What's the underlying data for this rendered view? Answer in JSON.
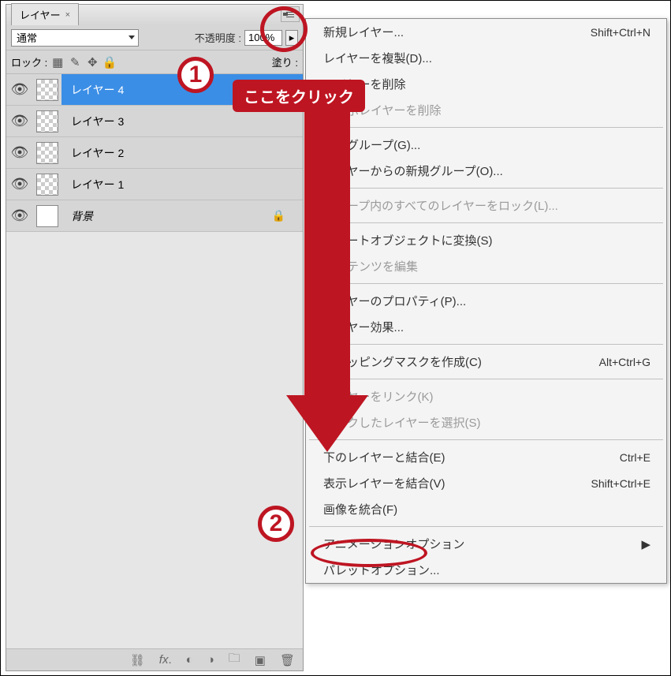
{
  "panel": {
    "tab_label": "レイヤー",
    "blend_mode": "通常",
    "opacity_label": "不透明度 :",
    "opacity_value": "100%",
    "lock_label": "ロック :",
    "fill_label": "塗り :"
  },
  "layers": [
    {
      "name": "レイヤー 4",
      "selected": true,
      "bg": false
    },
    {
      "name": "レイヤー 3",
      "selected": false,
      "bg": false
    },
    {
      "name": "レイヤー 2",
      "selected": false,
      "bg": false
    },
    {
      "name": "レイヤー 1",
      "selected": false,
      "bg": false
    },
    {
      "name": "背景",
      "selected": false,
      "bg": true
    }
  ],
  "menu": {
    "new_layer": "新規レイヤー...",
    "new_layer_sc": "Shift+Ctrl+N",
    "duplicate": "レイヤーを複製(D)...",
    "delete": "レイヤーを削除",
    "delete_hidden": "非表示レイヤーを削除",
    "new_group": "新規グループ(G)...",
    "group_from_layers": "レイヤーからの新規グループ(O)...",
    "lock_all_in_group": "グループ内のすべてのレイヤーをロック(L)...",
    "smart_object": "スマートオブジェクトに変換(S)",
    "edit_contents": "コンテンツを編集",
    "layer_properties": "レイヤーのプロパティ(P)...",
    "layer_style": "レイヤー効果...",
    "clip_mask": "クリッピングマスクを作成(C)",
    "clip_mask_sc": "Alt+Ctrl+G",
    "link_layers": "レイヤーをリンク(K)",
    "select_linked": "リンクしたレイヤーを選択(S)",
    "merge_down": "下のレイヤーと結合(E)",
    "merge_down_sc": "Ctrl+E",
    "merge_visible": "表示レイヤーを結合(V)",
    "merge_visible_sc": "Shift+Ctrl+E",
    "flatten": "画像を統合(F)",
    "anim_options": "アニメーションオプション",
    "palette_options": "パレットオプション..."
  },
  "annot": {
    "num1": "1",
    "num2": "2",
    "callout": "ここをクリック"
  }
}
